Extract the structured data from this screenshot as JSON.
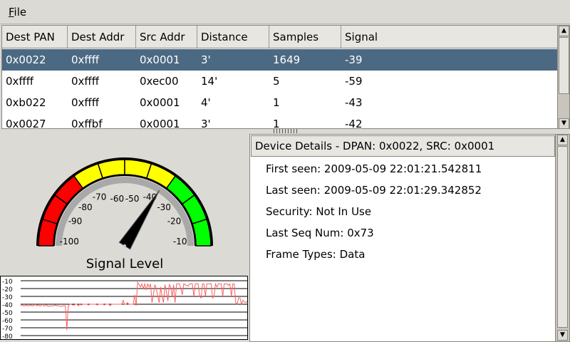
{
  "menu": {
    "file_label": "File"
  },
  "table": {
    "columns": [
      "Dest PAN",
      "Dest Addr",
      "Src Addr",
      "Distance",
      "Samples",
      "Signal"
    ],
    "rows": [
      [
        "0x0022",
        "0xffff",
        "0x0001",
        "3'",
        "1649",
        "-39"
      ],
      [
        "0xffff",
        "0xffff",
        "0xec00",
        "14'",
        "5",
        "-59"
      ],
      [
        "0xb022",
        "0xffff",
        "0x0001",
        "4'",
        "1",
        "-43"
      ],
      [
        "0x0027",
        "0xffbf",
        "0x0001",
        "3'",
        "1",
        "-42"
      ]
    ],
    "selected_row": 0
  },
  "gauge": {
    "title": "Signal Level",
    "min": -100,
    "max": -10,
    "value": -39,
    "tick_labels": [
      "-100",
      "-90",
      "-80",
      "-70",
      "-60",
      "-50",
      "-40",
      "-30",
      "-20",
      "-10"
    ],
    "colors": {
      "red": "#ff0000",
      "yellow": "#ffff00",
      "green": "#00ff00"
    }
  },
  "history": {
    "y_labels": [
      "-10",
      "-20",
      "-30",
      "-40",
      "-50",
      "-60",
      "-70",
      "-80"
    ],
    "line_color": "#ff6060",
    "values": [
      -42,
      -41,
      -42,
      -42,
      -41,
      -42,
      -42,
      -41,
      -42,
      -42,
      -40,
      -42,
      -41,
      -42,
      -42,
      -40,
      -42,
      -42,
      -41,
      -43,
      -42,
      -42,
      -42,
      -42,
      -41,
      -42,
      -42,
      -42,
      -43,
      -42,
      -42,
      -42,
      -73,
      -42,
      -40,
      -40,
      -41,
      -41,
      -40,
      -40,
      -42,
      -40,
      -41,
      -40,
      -40,
      -40,
      -40,
      -41,
      -40,
      -40,
      -40,
      -40,
      -40,
      -41,
      -40,
      -40,
      -40,
      -40,
      -41,
      -40,
      -40,
      -40,
      -42,
      -40,
      -40,
      -40,
      -40,
      -40,
      -40,
      -40,
      -40,
      -35,
      -40,
      -40,
      -38,
      -40,
      -40,
      -40,
      -40,
      -28,
      -42,
      -12,
      -15,
      -18,
      -14,
      -20,
      -14,
      -22,
      -14,
      -18,
      -14,
      -38,
      -28,
      -15,
      -20,
      -30,
      -38,
      -18,
      -30,
      -38,
      -15,
      -24,
      -36,
      -15,
      -18,
      -30,
      -15,
      -38,
      -14,
      -14,
      -14,
      -20,
      -28,
      -14,
      -15,
      -16,
      -17,
      -14,
      -14,
      -14,
      -30,
      -14,
      -14,
      -14,
      -30,
      -32,
      -14,
      -14,
      -30,
      -14,
      -14,
      -14,
      -14,
      -32,
      -30,
      -14,
      -18,
      -14,
      -14,
      -14,
      -30,
      -14,
      -14,
      -14,
      -16,
      -14,
      -30,
      -14,
      -14,
      -38,
      -40,
      -32,
      -32,
      -40,
      -35,
      -37,
      -38,
      -36
    ]
  },
  "details": {
    "header": "Device Details - DPAN: 0x0022, SRC: 0x0001",
    "lines": [
      "First seen: 2009-05-09 22:01:21.542811",
      "Last seen: 2009-05-09 22:01:29.342852",
      "Security: Not In Use",
      "Last Seq Num: 0x73",
      "Frame Types: Data"
    ]
  }
}
